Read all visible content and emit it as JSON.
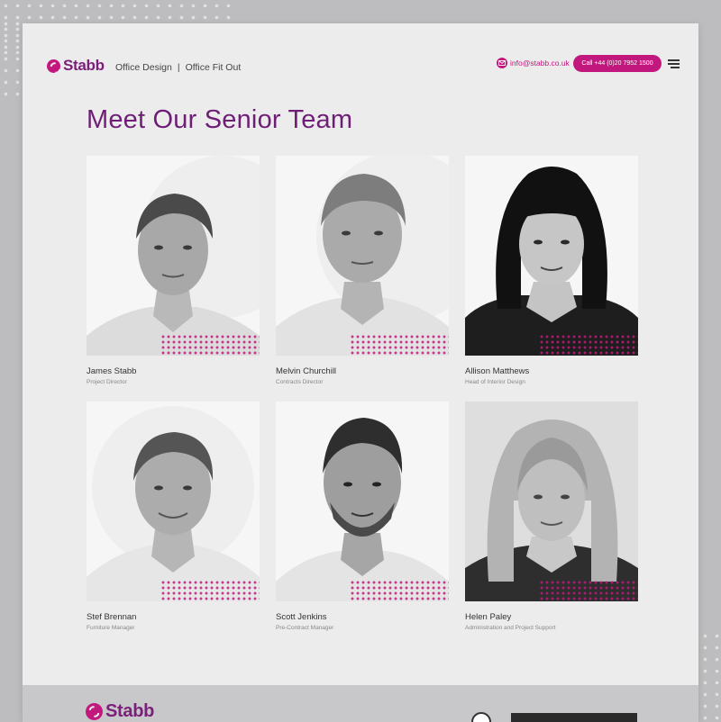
{
  "brand": {
    "name": "Stabb",
    "accent_color": "#c2187d",
    "title_color": "#6e1f75"
  },
  "header": {
    "nav": [
      "Office Design",
      "Office Fit Out"
    ],
    "separator": "|",
    "email": "info@stabb.co.uk",
    "call_label": "Call +44 (0)20 7952 1500"
  },
  "main": {
    "title": "Meet Our Senior Team",
    "team": [
      {
        "name": "James Stabb",
        "role": "Project Director"
      },
      {
        "name": "Melvin Churchill",
        "role": "Contracts Director"
      },
      {
        "name": "Allison Matthews",
        "role": "Head of Interior Design"
      },
      {
        "name": "Stef Brennan",
        "role": "Furniture Manager"
      },
      {
        "name": "Scott Jenkins",
        "role": "Pre-Contract Manager"
      },
      {
        "name": "Helen Paley",
        "role": "Administration and Project Support"
      }
    ]
  },
  "footer": {
    "brand": "Stabb"
  }
}
